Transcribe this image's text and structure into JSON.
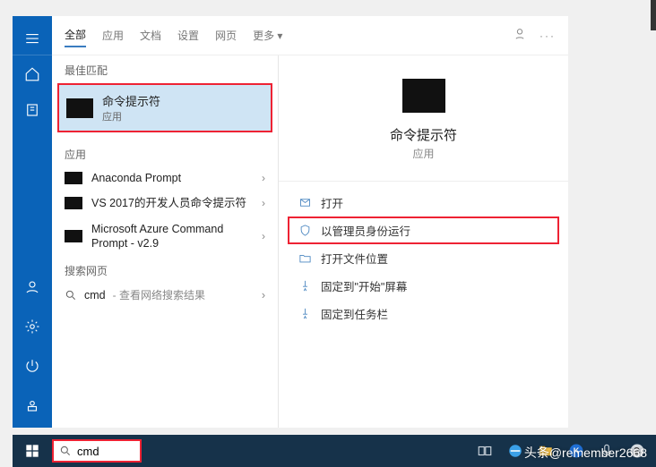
{
  "tabs": {
    "all": "全部",
    "apps": "应用",
    "docs": "文档",
    "settings": "设置",
    "web": "网页",
    "more": "更多"
  },
  "sections": {
    "best": "最佳匹配",
    "apps": "应用",
    "web": "搜索网页"
  },
  "best_match": {
    "title": "命令提示符",
    "type": "应用"
  },
  "apps": [
    {
      "label": "Anaconda Prompt"
    },
    {
      "label": "VS 2017的开发人员命令提示符"
    },
    {
      "label": "Microsoft Azure Command Prompt - v2.9"
    }
  ],
  "web_search": {
    "query": "cmd",
    "hint": "- 查看网络搜索结果"
  },
  "preview": {
    "title": "命令提示符",
    "type": "应用"
  },
  "actions": {
    "open": "打开",
    "run_admin": "以管理员身份运行",
    "open_loc": "打开文件位置",
    "pin_start": "固定到\"开始\"屏幕",
    "pin_task": "固定到任务栏"
  },
  "search_value": "cmd",
  "watermark": "头条@remember2668"
}
